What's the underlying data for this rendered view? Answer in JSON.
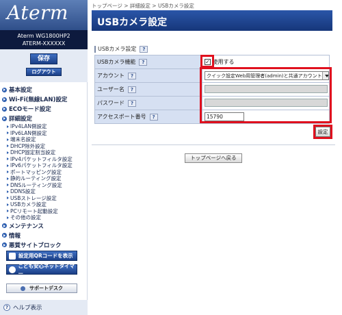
{
  "sidebar": {
    "logo": "Aterm",
    "model_line1": "Aterm WG1800HP2",
    "model_line2": "ATERM-XXXXXX",
    "save_label": "保存",
    "logout_label": "ログアウト",
    "nav": [
      {
        "label": "基本設定",
        "type": "top"
      },
      {
        "label": "Wi-Fi(無線LAN)設定",
        "type": "top"
      },
      {
        "label": "ECOモード設定",
        "type": "top"
      },
      {
        "label": "詳細設定",
        "type": "top"
      },
      {
        "label": "IPv4LAN側設定",
        "type": "sub"
      },
      {
        "label": "IPv6LAN側設定",
        "type": "sub"
      },
      {
        "label": "端末名設定",
        "type": "sub"
      },
      {
        "label": "DHCP除外設定",
        "type": "sub"
      },
      {
        "label": "DHCP固定割当設定",
        "type": "sub"
      },
      {
        "label": "IPv4パケットフィルタ設定",
        "type": "sub"
      },
      {
        "label": "IPv6パケットフィルタ設定",
        "type": "sub"
      },
      {
        "label": "ポートマッピング設定",
        "type": "sub"
      },
      {
        "label": "静的ルーティング設定",
        "type": "sub"
      },
      {
        "label": "DNSルーティング設定",
        "type": "sub"
      },
      {
        "label": "DDNS設定",
        "type": "sub"
      },
      {
        "label": "USBストレージ設定",
        "type": "sub"
      },
      {
        "label": "USBカメラ設定",
        "type": "sub"
      },
      {
        "label": "PCリモート起動設定",
        "type": "sub"
      },
      {
        "label": "その他の設定",
        "type": "sub"
      },
      {
        "label": "メンテナンス",
        "type": "top"
      },
      {
        "label": "情報",
        "type": "top"
      },
      {
        "label": "悪質サイトブロック",
        "type": "top"
      }
    ],
    "qr_button": "設定用QRコードを表示",
    "kids_button": "こども安心ネットタイマー",
    "support_button": "サポートデスク",
    "help_label": "ヘルプ表示"
  },
  "main": {
    "breadcrumb": "トップページ > 詳細設定 > USBカメラ設定",
    "title": "USBカメラ設定",
    "section": "USBカメラ設定",
    "help_icon": "?",
    "rows": {
      "usb_camera": {
        "label": "USBカメラ機能",
        "checkbox_text": "使用する",
        "checked": true
      },
      "account": {
        "label": "アカウント",
        "value": "クイック設定Web用管理者(admin)と共通アカウント"
      },
      "username": {
        "label": "ユーザー名"
      },
      "password": {
        "label": "パスワード"
      },
      "port": {
        "label": "アクセスポート番号",
        "value": "15790"
      }
    },
    "set_button": "設定",
    "top_button": "トップページへ戻る"
  },
  "colors": {
    "title_bar": "#1f4894",
    "row_label_bg": "#d6e0f2",
    "highlight": "#e0101e"
  }
}
